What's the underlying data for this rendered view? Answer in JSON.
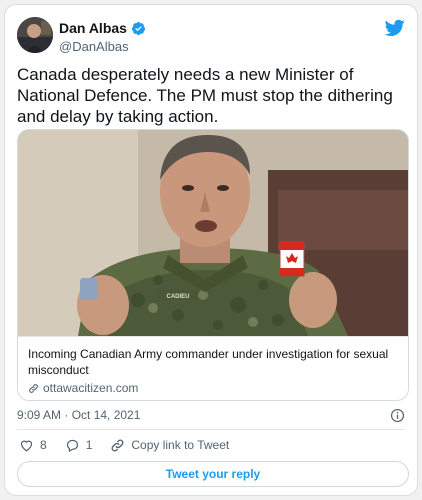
{
  "author": {
    "name": "Dan Albas",
    "handle": "@DanAlbas",
    "verified": true
  },
  "tweet": {
    "text": "Canada desperately needs a new Minister of National Defence. The PM must stop the dithering and delay by taking action."
  },
  "link_card": {
    "title": "Incoming Canadian Army commander under investigation for sexual misconduct",
    "domain": "ottawacitizen.com",
    "image_name_tag": "CADIEU"
  },
  "timestamp": "9:09 AM · Oct 14, 2021",
  "actions": {
    "likes": "8",
    "replies": "1",
    "copy_link": "Copy link to Tweet"
  },
  "reply_button": "Tweet your reply",
  "colors": {
    "accent": "#1d9bf0",
    "like": "#536471",
    "text": "#0f1419",
    "muted": "#536471"
  },
  "icons": [
    "avatar",
    "verified-badge-icon",
    "twitter-bird-icon",
    "link-icon",
    "info-icon",
    "heart-icon",
    "reply-icon",
    "copy-link-icon"
  ]
}
